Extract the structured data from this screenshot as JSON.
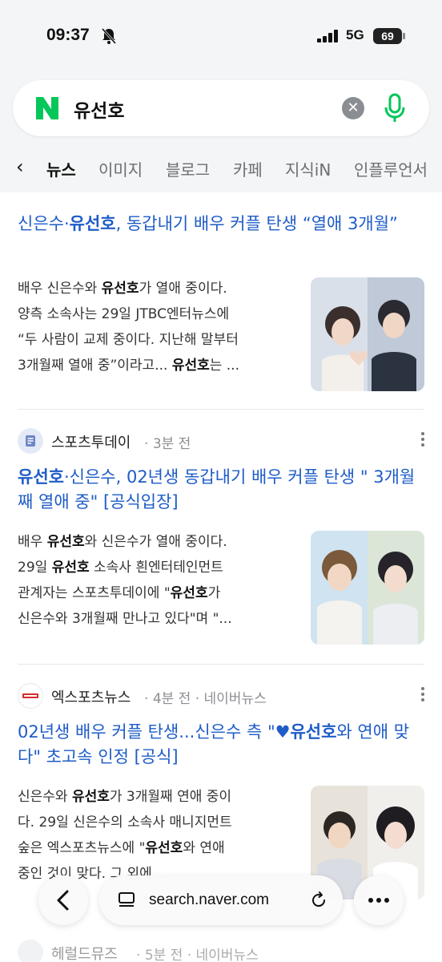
{
  "status": {
    "time": "09:37",
    "network": "5G",
    "battery": "69"
  },
  "search": {
    "query": "유선호"
  },
  "tabs": [
    "뉴스",
    "이미지",
    "블로그",
    "카페",
    "지식iN",
    "인플루언서"
  ],
  "articles": [
    {
      "title_prefix": "신은수·",
      "title_bold": "유선호",
      "title_rest": ", 동갑내기 배우 커플 탄생 “열애 3개월”",
      "snippet_lines": [
        [
          "배우 신은수와 ",
          "유선호",
          "가 열애 중이다."
        ],
        [
          "양측 소속사는 29일 JTBC엔터뉴스에"
        ],
        [
          "“두 사람이 교제 중이다. 지난해 말부터"
        ],
        [
          "3개월째 열애 중”이라고... ",
          "유선호",
          "는 ..."
        ]
      ]
    },
    {
      "source": "스포츠투데이",
      "time": "3분 전",
      "title_bold": "유선호",
      "title_rest": "·신은수, 02년생 동갑내기 배우 커플 탄생 \" 3개월째 열애 중\" [공식입장]",
      "snippet_lines": [
        [
          "배우 ",
          "유선호",
          "와 신은수가 열애 중이다."
        ],
        [
          "29일 ",
          "유선호",
          " 소속사 흰엔터테인먼트"
        ],
        [
          "관계자는 스포츠투데이에 \"",
          "유선호",
          "가"
        ],
        [
          "신은수와 3개월째 만나고 있다\"며 \"..."
        ]
      ]
    },
    {
      "source": "엑스포츠뉴스",
      "time": "4분 전",
      "origin": "네이버뉴스",
      "title_prefix": "02년생 배우 커플 탄생...신은수 측 \"",
      "title_heart": "♥",
      "title_bold": "유선호",
      "title_rest": "와 연애 맞다\" 초고속 인정 [공식]",
      "snippet_lines": [
        [
          "신은수와 ",
          "유선호",
          "가 3개월째 연애 중이"
        ],
        [
          "다. 29일 신은수의 소속사 매니지먼트"
        ],
        [
          "숲은 엑스포츠뉴스에 \"",
          "유선호",
          "와 연애"
        ],
        [
          "중인 것이 맞다. 그 외에 ..."
        ]
      ]
    },
    {
      "source": "헤럴드뮤즈",
      "time": "5분 전",
      "origin": "네이버뉴스"
    }
  ],
  "browser": {
    "url": "search.naver.com"
  },
  "colors": {
    "naver_green": "#03c75a",
    "link_blue": "#1e5cc7"
  }
}
